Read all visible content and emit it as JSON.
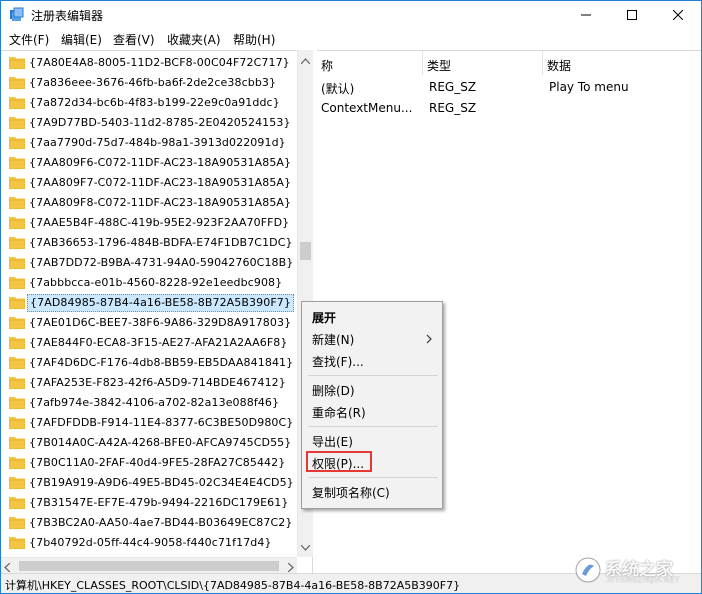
{
  "window": {
    "title": "注册表编辑器",
    "accent": "#1f7fd6"
  },
  "menubar": {
    "items": [
      "文件(F)",
      "编辑(E)",
      "查看(V)",
      "收藏夹(A)",
      "帮助(H)"
    ]
  },
  "tree": {
    "selected_index": 12,
    "folder_color": "#f4c542",
    "keys": [
      "{7A80E4A8-8005-11D2-BCF8-00C04F72C717}",
      "{7a836eee-3676-46fb-ba6f-2de2ce38cbb3}",
      "{7a872d34-bc6b-4f83-b199-22e9c0a91ddc}",
      "{7A9D77BD-5403-11d2-8785-2E0420524153}",
      "{7aa7790d-75d7-484b-98a1-3913d022091d}",
      "{7AA809F6-C072-11DF-AC23-18A90531A85A}",
      "{7AA809F7-C072-11DF-AC23-18A90531A85A}",
      "{7AA809F8-C072-11DF-AC23-18A90531A85A}",
      "{7AAE5B4F-488C-419b-95E2-923F2AA70FFD}",
      "{7AB36653-1796-484B-BDFA-E74F1DB7C1DC}",
      "{7AB7DD72-B9BA-4731-94A0-59042760C18B}",
      "{7abbbcca-e01b-4560-8228-92e1eedbc908}",
      "{7AD84985-87B4-4a16-BE58-8B72A5B390F7}",
      "{7AE01D6C-BEE7-38F6-9A86-329D8A917803}",
      "{7AE844F0-ECA8-3F15-AE27-AFA21A2AA6F8}",
      "{7AF4D6DC-F176-4db8-BB59-EB5DAA841841}",
      "{7AFA253E-F823-42f6-A5D9-714BDE467412}",
      "{7afb974e-3842-4106-a702-82a13e088f46}",
      "{7AFDFDDB-F914-11E4-8377-6C3BE50D980C}",
      "{7B014A0C-A42A-4268-BFE0-AFCA9745CD55}",
      "{7B0C11A0-2FAF-40d4-9FE5-28FA27C85442}",
      "{7B19A919-A9D6-49E5-BD45-02C34E4E4CD5}",
      "{7B31547E-EF7E-479b-9494-2216DC179E61}",
      "{7B3BC2A0-AA50-4ae7-BD44-B03649EC87C2}",
      "{7b40792d-05ff-44c4-9058-f440c71f17d4}"
    ]
  },
  "values": {
    "headers": [
      "称",
      "类型",
      "数据"
    ],
    "rows": [
      {
        "name": "(默认)",
        "type": "REG_SZ",
        "data": "Play To menu"
      },
      {
        "name": "ContextMenu...",
        "type": "REG_SZ",
        "data": ""
      }
    ]
  },
  "context_menu": {
    "expand": "展开",
    "new": "新建(N)",
    "find": "查找(F)...",
    "delete": "删除(D)",
    "rename": "重命名(R)",
    "export": "导出(E)",
    "permissions": "权限(P)...",
    "copy_key_name": "复制项名称(C)",
    "highlight_color": "#e53935"
  },
  "statusbar": {
    "path": "计算机\\HKEY_CLASSES_ROOT\\CLSID\\{7AD84985-87B4-4a16-BE58-8B72A5B390F7}"
  },
  "watermark": {
    "text": "系统之家",
    "url": "XITONGZHIJIA.NET"
  }
}
